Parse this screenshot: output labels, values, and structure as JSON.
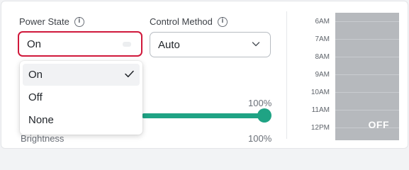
{
  "power_state": {
    "label": "Power State",
    "value": "On",
    "options": [
      {
        "label": "On",
        "selected": true
      },
      {
        "label": "Off",
        "selected": false
      },
      {
        "label": "None",
        "selected": false
      }
    ]
  },
  "control_method": {
    "label": "Control Method",
    "value": "Auto"
  },
  "slider": {
    "percent_label": "100%",
    "level": 1.0
  },
  "brightness": {
    "label": "Brightness",
    "percent_label": "100%"
  },
  "schedule": {
    "times": [
      "6AM",
      "7AM",
      "8AM",
      "9AM",
      "10AM",
      "11AM",
      "12PM"
    ],
    "state_label": "OFF"
  },
  "colors": {
    "accent_green": "#1fa384",
    "focus_red": "#d0183b",
    "schedule_off": "#b6b9bd"
  }
}
